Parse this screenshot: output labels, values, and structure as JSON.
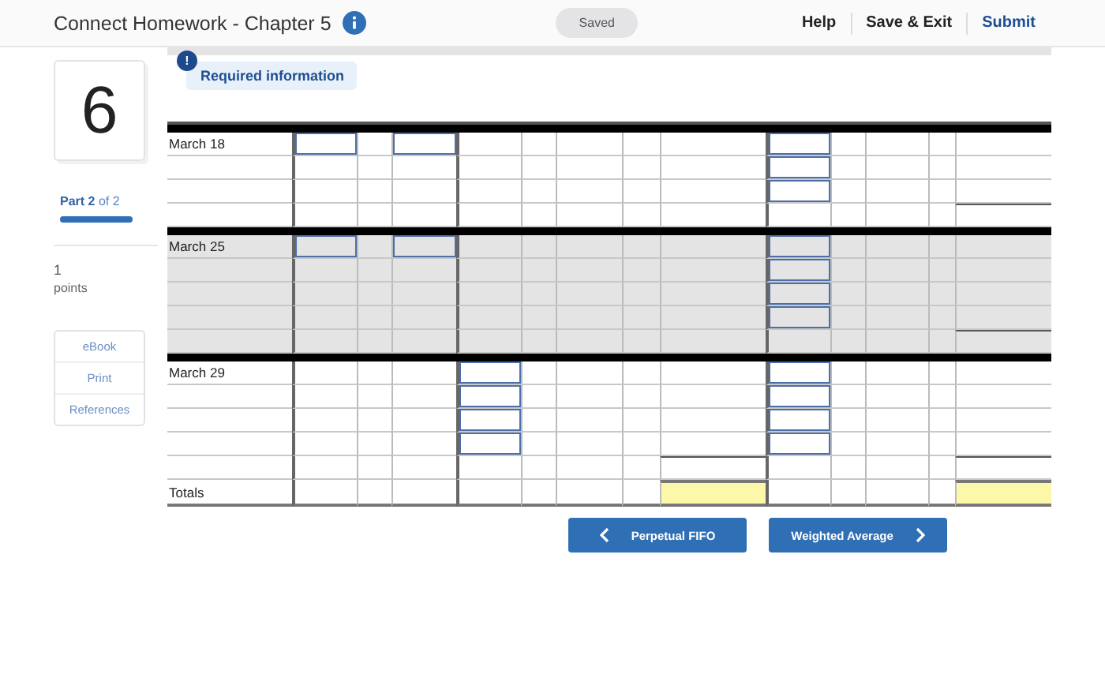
{
  "header": {
    "title": "Connect Homework - Chapter 5",
    "status": "Saved",
    "actions": [
      {
        "label": "Help",
        "kind": "plain"
      },
      {
        "label": "Save & Exit",
        "kind": "plain"
      },
      {
        "label": "Submit",
        "kind": "primary"
      }
    ]
  },
  "sidebar": {
    "question_number": "6",
    "part": "**Part 2** of 2",
    "level": 1,
    "points_value": "1",
    "points_label": "points",
    "tools": [
      "eBook",
      "Print",
      "References"
    ]
  },
  "notice": {
    "label": "Required information",
    "icon_text": "!"
  },
  "groups": [
    {
      "date": "March 18",
      "shaded": false,
      "rows": [
        {
          "kind": "purchase"
        },
        {
          "kind": "layer"
        },
        {
          "kind": "layer"
        },
        {
          "kind": "balance_end"
        }
      ]
    },
    {
      "date": "March 25",
      "shaded": true,
      "rows": [
        {
          "kind": "purchase"
        },
        {
          "kind": "layer"
        },
        {
          "kind": "layer"
        },
        {
          "kind": "layer"
        },
        {
          "kind": "balance_end"
        }
      ]
    },
    {
      "date": "March 29",
      "shaded": false,
      "rows": [
        {
          "kind": "sale"
        },
        {
          "kind": "sale"
        },
        {
          "kind": "sale"
        },
        {
          "kind": "sale"
        },
        {
          "kind": "sale_end"
        }
      ]
    }
  ],
  "totals": {
    "label": "Totals",
    "kind": "totals"
  },
  "nav": [
    {
      "label": "Perpetual FIFO",
      "kind": "prev"
    },
    {
      "label": "Weighted Average",
      "kind": "next"
    }
  ]
}
